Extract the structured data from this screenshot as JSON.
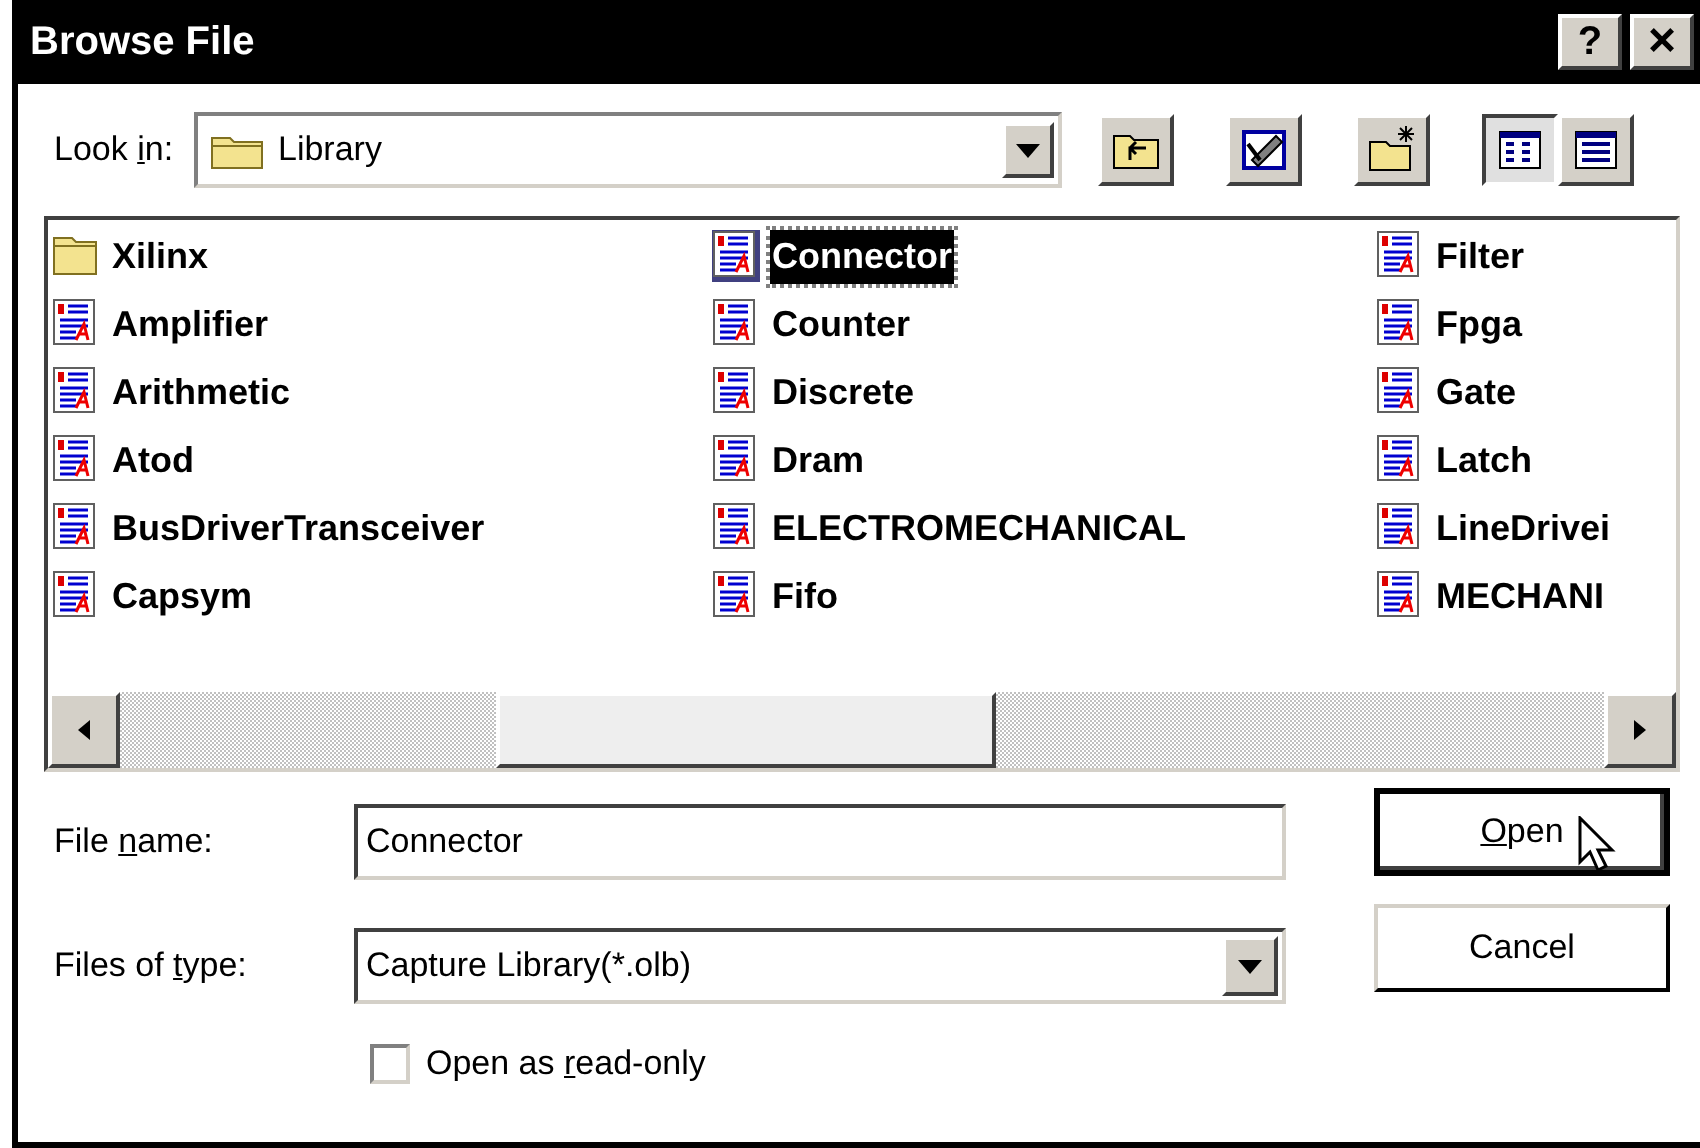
{
  "window": {
    "title": "Browse File",
    "help_button": "?",
    "close_button": "×"
  },
  "look_in": {
    "label": {
      "before": "Look ",
      "key": "i",
      "after": "n:"
    },
    "value": "Library"
  },
  "toolbar": [
    {
      "kind": "up"
    },
    {
      "kind": "new-folder"
    },
    {
      "kind": "new-item"
    },
    {
      "kind": "list-view",
      "selected": true
    },
    {
      "kind": "details-view",
      "selected": false
    }
  ],
  "files": {
    "columns": [
      [
        {
          "name": "Xilinx",
          "kind": "folder",
          "selected": false
        },
        {
          "name": "Amplifier",
          "kind": "library",
          "selected": false
        },
        {
          "name": "Arithmetic",
          "kind": "library",
          "selected": false
        },
        {
          "name": "Atod",
          "kind": "library",
          "selected": false
        },
        {
          "name": "BusDriverTransceiver",
          "kind": "library",
          "selected": false
        },
        {
          "name": "Capsym",
          "kind": "library",
          "selected": false
        }
      ],
      [
        {
          "name": "Connector",
          "kind": "library",
          "selected": true
        },
        {
          "name": "Counter",
          "kind": "library",
          "selected": false
        },
        {
          "name": "Discrete",
          "kind": "library",
          "selected": false
        },
        {
          "name": "Dram",
          "kind": "library",
          "selected": false
        },
        {
          "name": "ELECTROMECHANICAL",
          "kind": "library",
          "selected": false
        },
        {
          "name": "Fifo",
          "kind": "library",
          "selected": false
        }
      ],
      [
        {
          "name": "Filter",
          "kind": "library",
          "selected": false
        },
        {
          "name": "Fpga",
          "kind": "library",
          "selected": false
        },
        {
          "name": "Gate",
          "kind": "library",
          "selected": false
        },
        {
          "name": "Latch",
          "kind": "library",
          "selected": false
        },
        {
          "name": "LineDrivei",
          "kind": "library",
          "selected": false
        },
        {
          "name": "MECHANI",
          "kind": "library",
          "selected": false
        }
      ]
    ]
  },
  "file_name": {
    "label": {
      "before": "File ",
      "key": "n",
      "after": "ame:"
    },
    "value": "Connector"
  },
  "file_type": {
    "label": {
      "before": "Files of ",
      "key": "t",
      "after": "ype:"
    },
    "value": "Capture Library(*.olb)"
  },
  "read_only": {
    "label": {
      "before": "Open as ",
      "key": "r",
      "after": "ead-only"
    },
    "checked": false
  },
  "buttons": [
    {
      "label": {
        "key": "O",
        "after": "pen"
      },
      "default": true
    },
    {
      "label": {
        "before": "Cancel"
      },
      "default": false
    }
  ]
}
